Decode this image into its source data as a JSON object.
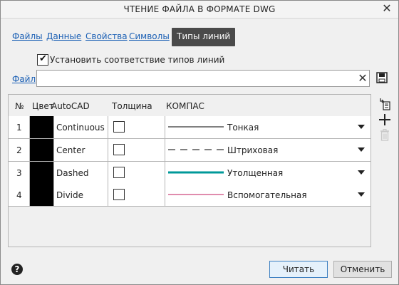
{
  "window": {
    "title": "ЧТЕНИЕ ФАЙЛА В ФОРМАТЕ DWG",
    "close_icon": "close-icon"
  },
  "tabs": [
    {
      "label": "Файлы",
      "active": false
    },
    {
      "label": "Данные",
      "active": false
    },
    {
      "label": "Свойства",
      "active": false
    },
    {
      "label": "Символы",
      "active": false
    },
    {
      "label": "Типы линий",
      "active": true
    }
  ],
  "options": {
    "match_linetypes_label": "Установить соответствие типов линий",
    "match_linetypes_checked": true
  },
  "file": {
    "label": "Файл",
    "value": ""
  },
  "table": {
    "headers": {
      "num": "№",
      "color": "Цвет",
      "autocad": "AutoCAD",
      "thickness": "Толщина",
      "kompas": "КОМПАС"
    },
    "rows": [
      {
        "num": "1",
        "color": "#000000",
        "autocad": "Continuous",
        "thick": false,
        "kompas": "Тонкая",
        "kompas_color": "#000000"
      },
      {
        "num": "2",
        "color": "#000000",
        "autocad": "Center",
        "thick": false,
        "kompas": "Штриховая",
        "kompas_color": "#000000"
      },
      {
        "num": "3",
        "color": "#000000",
        "autocad": "Dashed",
        "thick": false,
        "kompas": "Утолщенная",
        "kompas_color": "#00999a"
      },
      {
        "num": "4",
        "color": "#000000",
        "autocad": "Divide",
        "thick": false,
        "kompas": "Вспомогательная",
        "kompas_color": "#c2185b"
      }
    ]
  },
  "tools": [
    "import-linetype-icon",
    "add-icon",
    "delete-icon"
  ],
  "buttons": {
    "read": "Читать",
    "cancel": "Отменить"
  }
}
